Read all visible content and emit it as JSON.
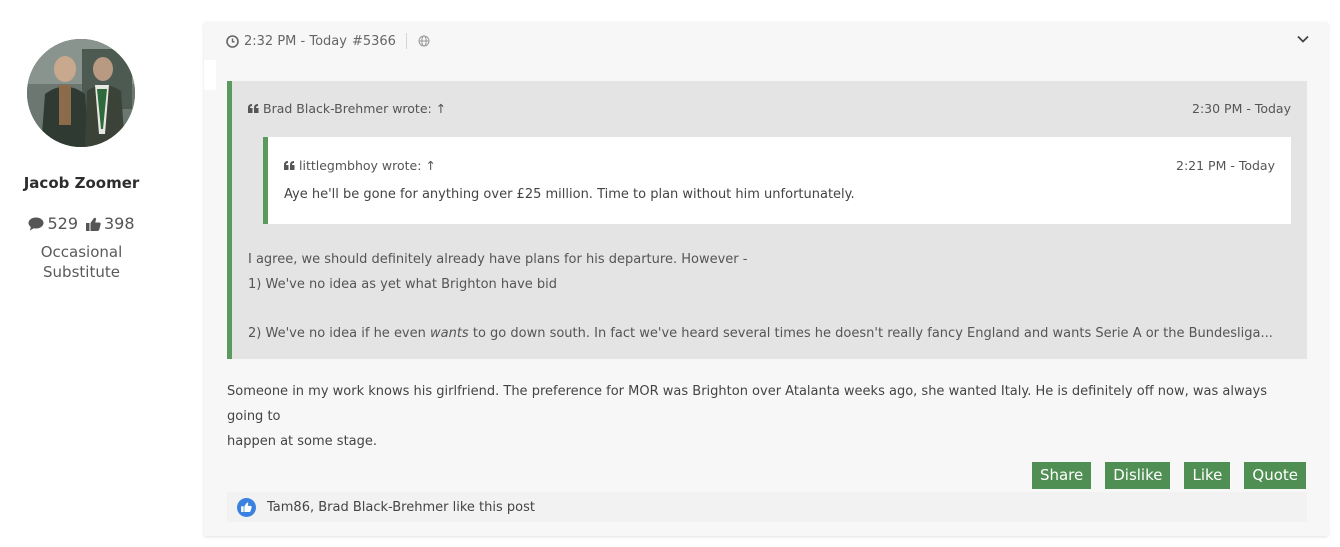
{
  "author": {
    "name": "Jacob Zoomer",
    "posts_count": "529",
    "likes_count": "398",
    "rank_line1": "Occasional",
    "rank_line2": "Substitute"
  },
  "post": {
    "time": "2:32 PM - Today",
    "number": "#5366",
    "quote": {
      "author": "Brad Black-Brehmer wrote:",
      "arrow": "↑",
      "time": "2:30 PM - Today",
      "nested": {
        "author": "littlegmbhoy wrote:",
        "arrow": "↑",
        "time": "2:21 PM - Today",
        "text": "Aye he'll be gone for anything over £25 million. Time to plan without him unfortunately."
      },
      "line1": "I agree, we should definitely already have plans for his departure. However -",
      "line2": "1) We've no idea as yet what Brighton have bid",
      "line3_pre": "2) We've no idea if he even ",
      "line3_em": "wants",
      "line3_post": " to go down south. In fact we've heard several times he doesn't really fancy England and wants Serie A or the Bundesliga..."
    },
    "body_line1": "Someone in my work knows his girlfriend. The preference for MOR was Brighton over Atalanta weeks ago, she wanted Italy. He is definitely off now, was always going to",
    "body_line2": "happen at some stage."
  },
  "actions": {
    "share": "Share",
    "dislike": "Dislike",
    "like": "Like",
    "quote": "Quote"
  },
  "likes_text": "Tam86, Brad Black-Brehmer like this post",
  "colors": {
    "accent_green": "#4f8f53",
    "quote_border": "#5b9a5e",
    "like_blue": "#3b82e0"
  }
}
